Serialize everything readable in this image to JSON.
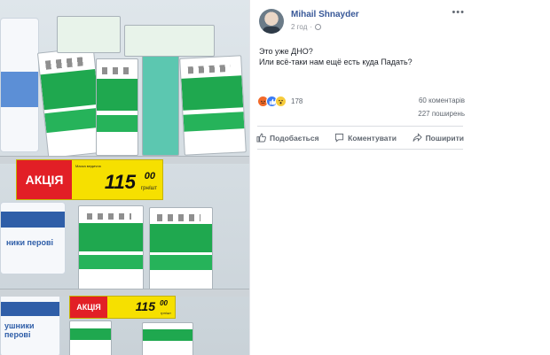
{
  "photo": {
    "promo_label_top": "АКЦІЯ",
    "price_top": "115",
    "price_top_cents": "00",
    "price_top_unit": "грн/шт",
    "promo_label_bottom": "АКЦІЯ",
    "price_bottom": "115",
    "price_bottom_cents": "00",
    "price_bottom_unit": "грн/шт",
    "product_text": "Маска медична",
    "roll_text_top": "ники перові",
    "roll_text_bottom": "ушники перові"
  },
  "post": {
    "author": "Mihail Shnayder",
    "time": "2 год",
    "more": "•••",
    "text_line1": "Это уже ДНО?",
    "text_line2": "Или всё-таки нам ещё есть куда Падать?",
    "reactions_count": "178",
    "comments_count": "60 коментарів",
    "shares_count": "227 поширень",
    "reaction_icons": [
      "angry-icon",
      "like-icon",
      "wow-icon"
    ],
    "actions": {
      "like": "Подобається",
      "comment": "Коментувати",
      "share": "Поширити"
    }
  },
  "colors": {
    "author_link": "#385898",
    "secondary_text": "#606770",
    "promo_red": "#e21f26",
    "price_yellow": "#f6e000",
    "mask_green": "#1fa84f"
  }
}
